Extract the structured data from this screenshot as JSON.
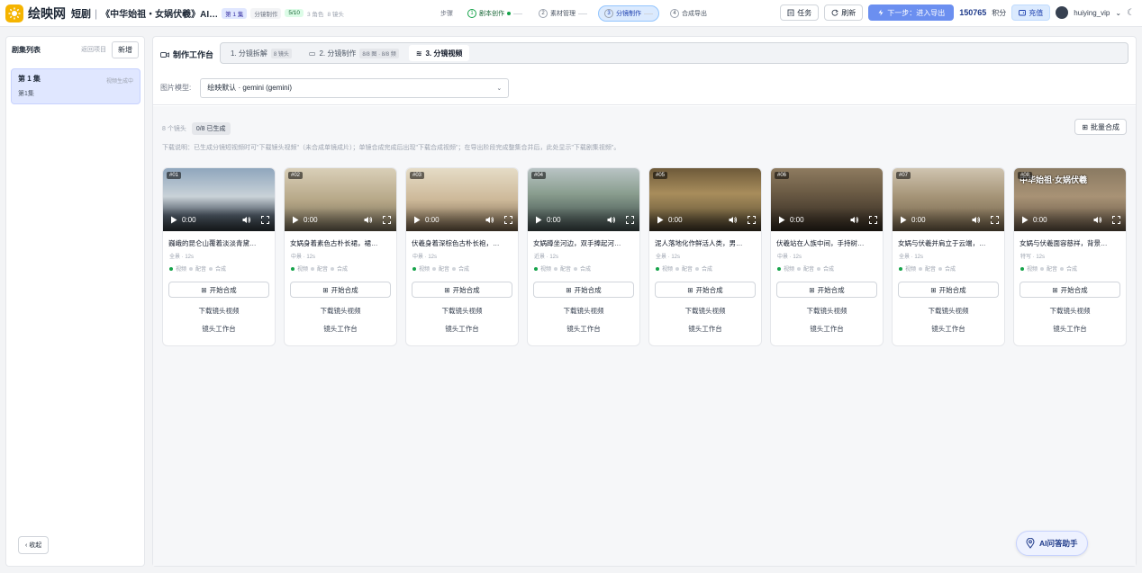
{
  "app": {
    "name": "绘映网",
    "mode": "短剧",
    "separator": "|",
    "project_title": "《中华始祖・女娲伏羲》AI短剧分…",
    "episode_chip": "第 1 集",
    "stage_chip": "分镜制作",
    "progress_chip": "5/10",
    "roles": "3 角色",
    "scenes": "8 镜头"
  },
  "steps": {
    "label": "步骤",
    "items": [
      {
        "num": "1",
        "label": "剧本创作",
        "state": "done"
      },
      {
        "num": "2",
        "label": "素材管理",
        "state": "todo"
      },
      {
        "num": "3",
        "label": "分镜制作",
        "state": "active"
      },
      {
        "num": "4",
        "label": "合成导出",
        "state": "todo"
      }
    ]
  },
  "toolbar": {
    "task": "任务",
    "refresh": "刷新",
    "next": "下一步：进入导出",
    "credits": "150765",
    "credits_unit": "积分",
    "recharge": "充值",
    "username": "huiying_vip",
    "user_chev": "⌄"
  },
  "sidebar": {
    "title": "剧集列表",
    "back": "返回项目",
    "new": "新增",
    "episode": {
      "title": "第 1 集",
      "status": "视频生成中",
      "sub": "第1集"
    },
    "collapse": "收起"
  },
  "workspace": {
    "title": "制作工作台",
    "tabs": [
      {
        "label": "1. 分镜拆解",
        "tag": "8 镜头"
      },
      {
        "label": "2. 分镜制作",
        "tag": "8/8 图 · 8/8 频"
      },
      {
        "label": "3. 分镜视频",
        "tag": ""
      }
    ],
    "model_label": "图片模型:",
    "model_value": "绘映默认 · gemini (gemini)"
  },
  "content": {
    "count": "8 个镜头",
    "generated": "0/8 已生成",
    "batch": "批量合成",
    "note": "下载说明：已生成分镜短视频时可\"下载镜头视频\"（未合成单镜成片）；单镜合成完成后出现\"下载合成视频\"；在导出阶段完成整集合并后，此处显示\"下载剧集视频\"。"
  },
  "card_labels": {
    "time": "0:00",
    "video": "视频",
    "dub": "配音",
    "merge": "合成",
    "start": "开始合成",
    "download": "下载镜头视频",
    "bench": "镜头工作台"
  },
  "cards": [
    {
      "id": "#01",
      "title": "巍峨的昆仑山覆着淡淡青黛…",
      "meta": "全景 · 12s",
      "thumb": "a"
    },
    {
      "id": "#02",
      "title": "女娲身着素色古朴长裙，裙…",
      "meta": "中景 · 12s",
      "thumb": "b"
    },
    {
      "id": "#03",
      "title": "伏羲身着深棕色古朴长袍，…",
      "meta": "中景 · 12s",
      "thumb": "c"
    },
    {
      "id": "#04",
      "title": "女娲蹲坐河边，双手捧起河…",
      "meta": "近景 · 12s",
      "thumb": "d"
    },
    {
      "id": "#05",
      "title": "泥人落地化作鲜活人类，男…",
      "meta": "全景 · 12s",
      "thumb": "e"
    },
    {
      "id": "#06",
      "title": "伏羲站在人族中间，手持树…",
      "meta": "中景 · 12s",
      "thumb": "f"
    },
    {
      "id": "#07",
      "title": "女娲与伏羲并肩立于云端，…",
      "meta": "全景 · 12s",
      "thumb": "g"
    },
    {
      "id": "#08",
      "title": "女娲与伏羲面容慈祥，背景…",
      "meta": "特写 · 12s",
      "thumb": "h",
      "overlay": "中华始祖·女娲伏羲"
    }
  ],
  "ai_assistant": "AI问答助手",
  "colors": {
    "accent": "#6b8ff0",
    "brand": "#f5b400",
    "ok": "#16a34a"
  }
}
